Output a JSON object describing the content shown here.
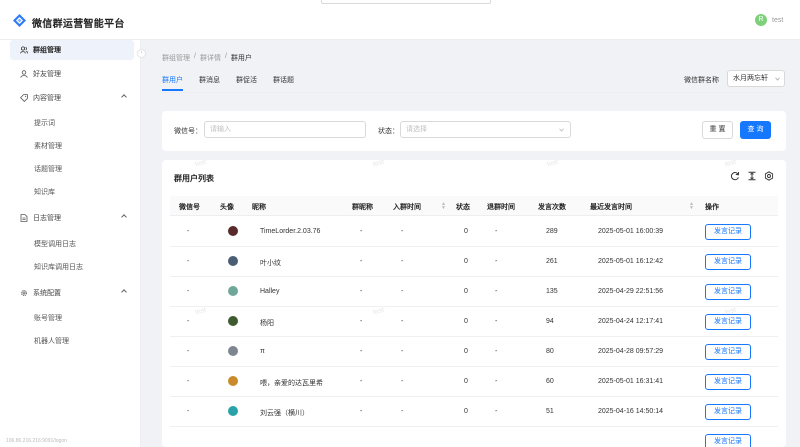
{
  "app": {
    "title": "微信群运营智能平台"
  },
  "user": {
    "avatar_letter": "R",
    "name": "test"
  },
  "watermark": "test",
  "sidebar": {
    "items": [
      {
        "label": "群组管理",
        "icon": "group-icon"
      },
      {
        "label": "好友管理",
        "icon": "user-icon"
      },
      {
        "label": "内容管理",
        "icon": "tag-icon"
      },
      {
        "label": "日志管理",
        "icon": "file-icon"
      },
      {
        "label": "系统配置",
        "icon": "gear-icon"
      }
    ],
    "content_sub": [
      "提示词",
      "素材管理",
      "话题管理",
      "知识库"
    ],
    "log_sub": [
      "模型调用日志",
      "知识库调用日志"
    ],
    "system_sub": [
      "账号管理",
      "机器人管理"
    ],
    "ip_text": "106.86.216.216:9091/logon"
  },
  "breadcrumb": [
    "群组管理",
    "群详情",
    "群用户"
  ],
  "tabs": [
    "群用户",
    "群消息",
    "群促活",
    "群话题"
  ],
  "group_select": {
    "label": "微信群名称",
    "value": "水月两忘轩"
  },
  "filters": {
    "wechat_label": "微信号：",
    "wechat_placeholder": "请输入",
    "status_label": "状态：",
    "status_placeholder": "请选择",
    "reset": "重 置",
    "query": "查 询"
  },
  "table": {
    "title": "群用户列表",
    "columns": [
      "微信号",
      "头像",
      "昵称",
      "群昵称",
      "入群时间",
      "状态",
      "退群时间",
      "发言次数",
      "最近发言时间",
      "操作"
    ],
    "action_label": "发言记录",
    "rows": [
      {
        "wechat": "-",
        "avatar_color": "#5a2a2a",
        "nickname": "TimeLorder.2.03.76",
        "group_nick": "-",
        "join": "-",
        "status": "0",
        "leave": "-",
        "count": "289",
        "last": "2025-05-01 16:00:39"
      },
      {
        "wechat": "-",
        "avatar_color": "#4a5d73",
        "nickname": "叶小纹",
        "group_nick": "-",
        "join": "-",
        "status": "0",
        "leave": "-",
        "count": "261",
        "last": "2025-05-01 16:12:42"
      },
      {
        "wechat": "-",
        "avatar_color": "#6fa89a",
        "nickname": "Halley",
        "group_nick": "-",
        "join": "-",
        "status": "0",
        "leave": "-",
        "count": "135",
        "last": "2025-04-29 22:51:56"
      },
      {
        "wechat": "-",
        "avatar_color": "#3f5a2e",
        "nickname": "杨阳",
        "group_nick": "-",
        "join": "-",
        "status": "0",
        "leave": "-",
        "count": "94",
        "last": "2025-04-24 12:17:41"
      },
      {
        "wechat": "-",
        "avatar_color": "#7d8590",
        "nickname": "π",
        "group_nick": "-",
        "join": "-",
        "status": "0",
        "leave": "-",
        "count": "80",
        "last": "2025-04-28 09:57:29"
      },
      {
        "wechat": "-",
        "avatar_color": "#c98a2b",
        "nickname": "喂，亲爱的达瓦里希",
        "group_nick": "-",
        "join": "-",
        "status": "0",
        "leave": "-",
        "count": "60",
        "last": "2025-05-01 16:31:41"
      },
      {
        "wechat": "-",
        "avatar_color": "#2aa3a8",
        "nickname": "刘云强（横川）",
        "group_nick": "-",
        "join": "-",
        "status": "0",
        "leave": "-",
        "count": "51",
        "last": "2025-04-16 14:50:14"
      },
      {
        "wechat": "",
        "avatar_color": "",
        "nickname": "",
        "group_nick": "",
        "join": "",
        "status": "",
        "leave": "",
        "count": "",
        "last": ""
      }
    ]
  },
  "colors": {
    "primary": "#1677ff",
    "avatar_green": "#7ed07a"
  }
}
